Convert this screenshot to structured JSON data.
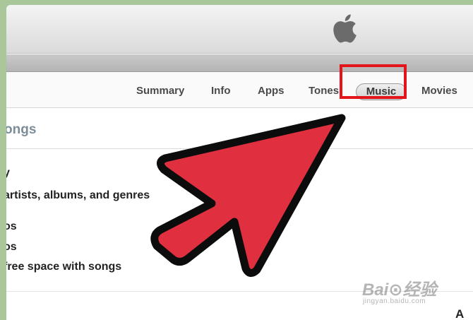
{
  "tabs": [
    {
      "label": "Summary"
    },
    {
      "label": "Info"
    },
    {
      "label": "Apps"
    },
    {
      "label": "Tones"
    },
    {
      "label": "Music",
      "selected": true
    },
    {
      "label": "Movies"
    }
  ],
  "section": {
    "title": "ongs"
  },
  "options": [
    "y",
    "artists, albums, and genres",
    "os",
    "os",
    "free space with songs"
  ],
  "corner_letter": "A",
  "watermark": {
    "brand": "Bai⊙经验",
    "url": "jingyan.baidu.com"
  },
  "colors": {
    "highlight": "#e4141b",
    "arrow_fill": "#e03040",
    "background": "#a9c79a"
  },
  "icons": [
    "apple-logo-icon",
    "pointer-arrow-icon"
  ]
}
